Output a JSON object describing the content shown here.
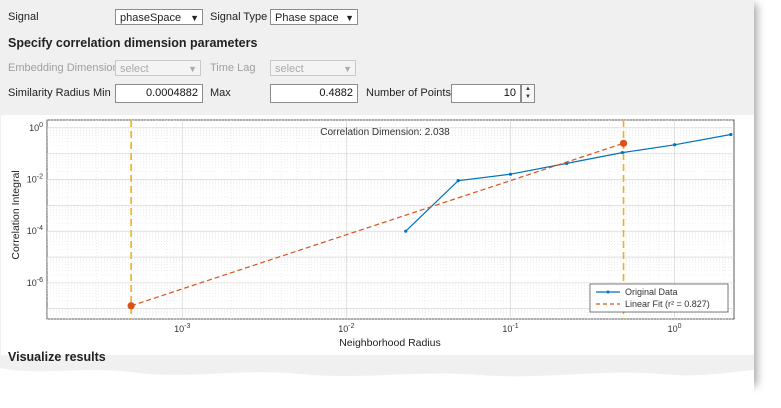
{
  "signal": {
    "label": "Signal",
    "value": "phaseSpace"
  },
  "signal_type": {
    "label": "Signal Type",
    "value": "Phase space"
  },
  "section_heading": "Specify correlation dimension parameters",
  "embedding": {
    "label": "Embedding Dimension",
    "value": "select"
  },
  "time_lag": {
    "label": "Time Lag",
    "value": "select"
  },
  "radius_min": {
    "label": "Similarity Radius Min",
    "value": "0.0004882"
  },
  "radius_max": {
    "label": "Max",
    "value": "0.4882"
  },
  "num_points": {
    "label": "Number of Points",
    "value": "10"
  },
  "visualize_heading": "Visualize results",
  "chart_data": {
    "type": "line",
    "annotation": "Correlation Dimension: 2.038",
    "xlabel": "Neighborhood Radius",
    "ylabel": "Correlation Integral",
    "xscale": "log",
    "yscale": "log",
    "xlim": [
      0.00015,
      2.3
    ],
    "ylim": [
      4e-08,
      2
    ],
    "grid": true,
    "legend_position": "bottom-right",
    "x_tick_labels": [
      "10-3",
      "10-2",
      "10-1",
      "100"
    ],
    "y_tick_labels": [
      "100",
      "10-2",
      "10-4",
      "10-6"
    ],
    "x_ticks": [
      0.001,
      0.01,
      0.1,
      1
    ],
    "y_ticks": [
      1,
      0.01,
      0.0001,
      1e-06
    ],
    "series": [
      {
        "name": "Original Data",
        "color": "#0072BD",
        "x": [
          0.023,
          0.048,
          0.1,
          0.22,
          0.48,
          1.0,
          2.2
        ],
        "y": [
          0.0001,
          0.009,
          0.016,
          0.042,
          0.11,
          0.22,
          0.55
        ]
      },
      {
        "name": "Linear Fit (r² = 0.827)",
        "color": "#D95319",
        "dashed": true,
        "x": [
          0.0004882,
          0.4882
        ],
        "y": [
          1.3e-07,
          0.25
        ]
      }
    ],
    "markers": [
      {
        "x": 0.0004882,
        "y": 1.3e-07
      },
      {
        "x": 0.4882,
        "y": 0.25
      }
    ],
    "vlines": [
      0.0004882,
      0.4882
    ],
    "vline_color": "#EDB120"
  }
}
